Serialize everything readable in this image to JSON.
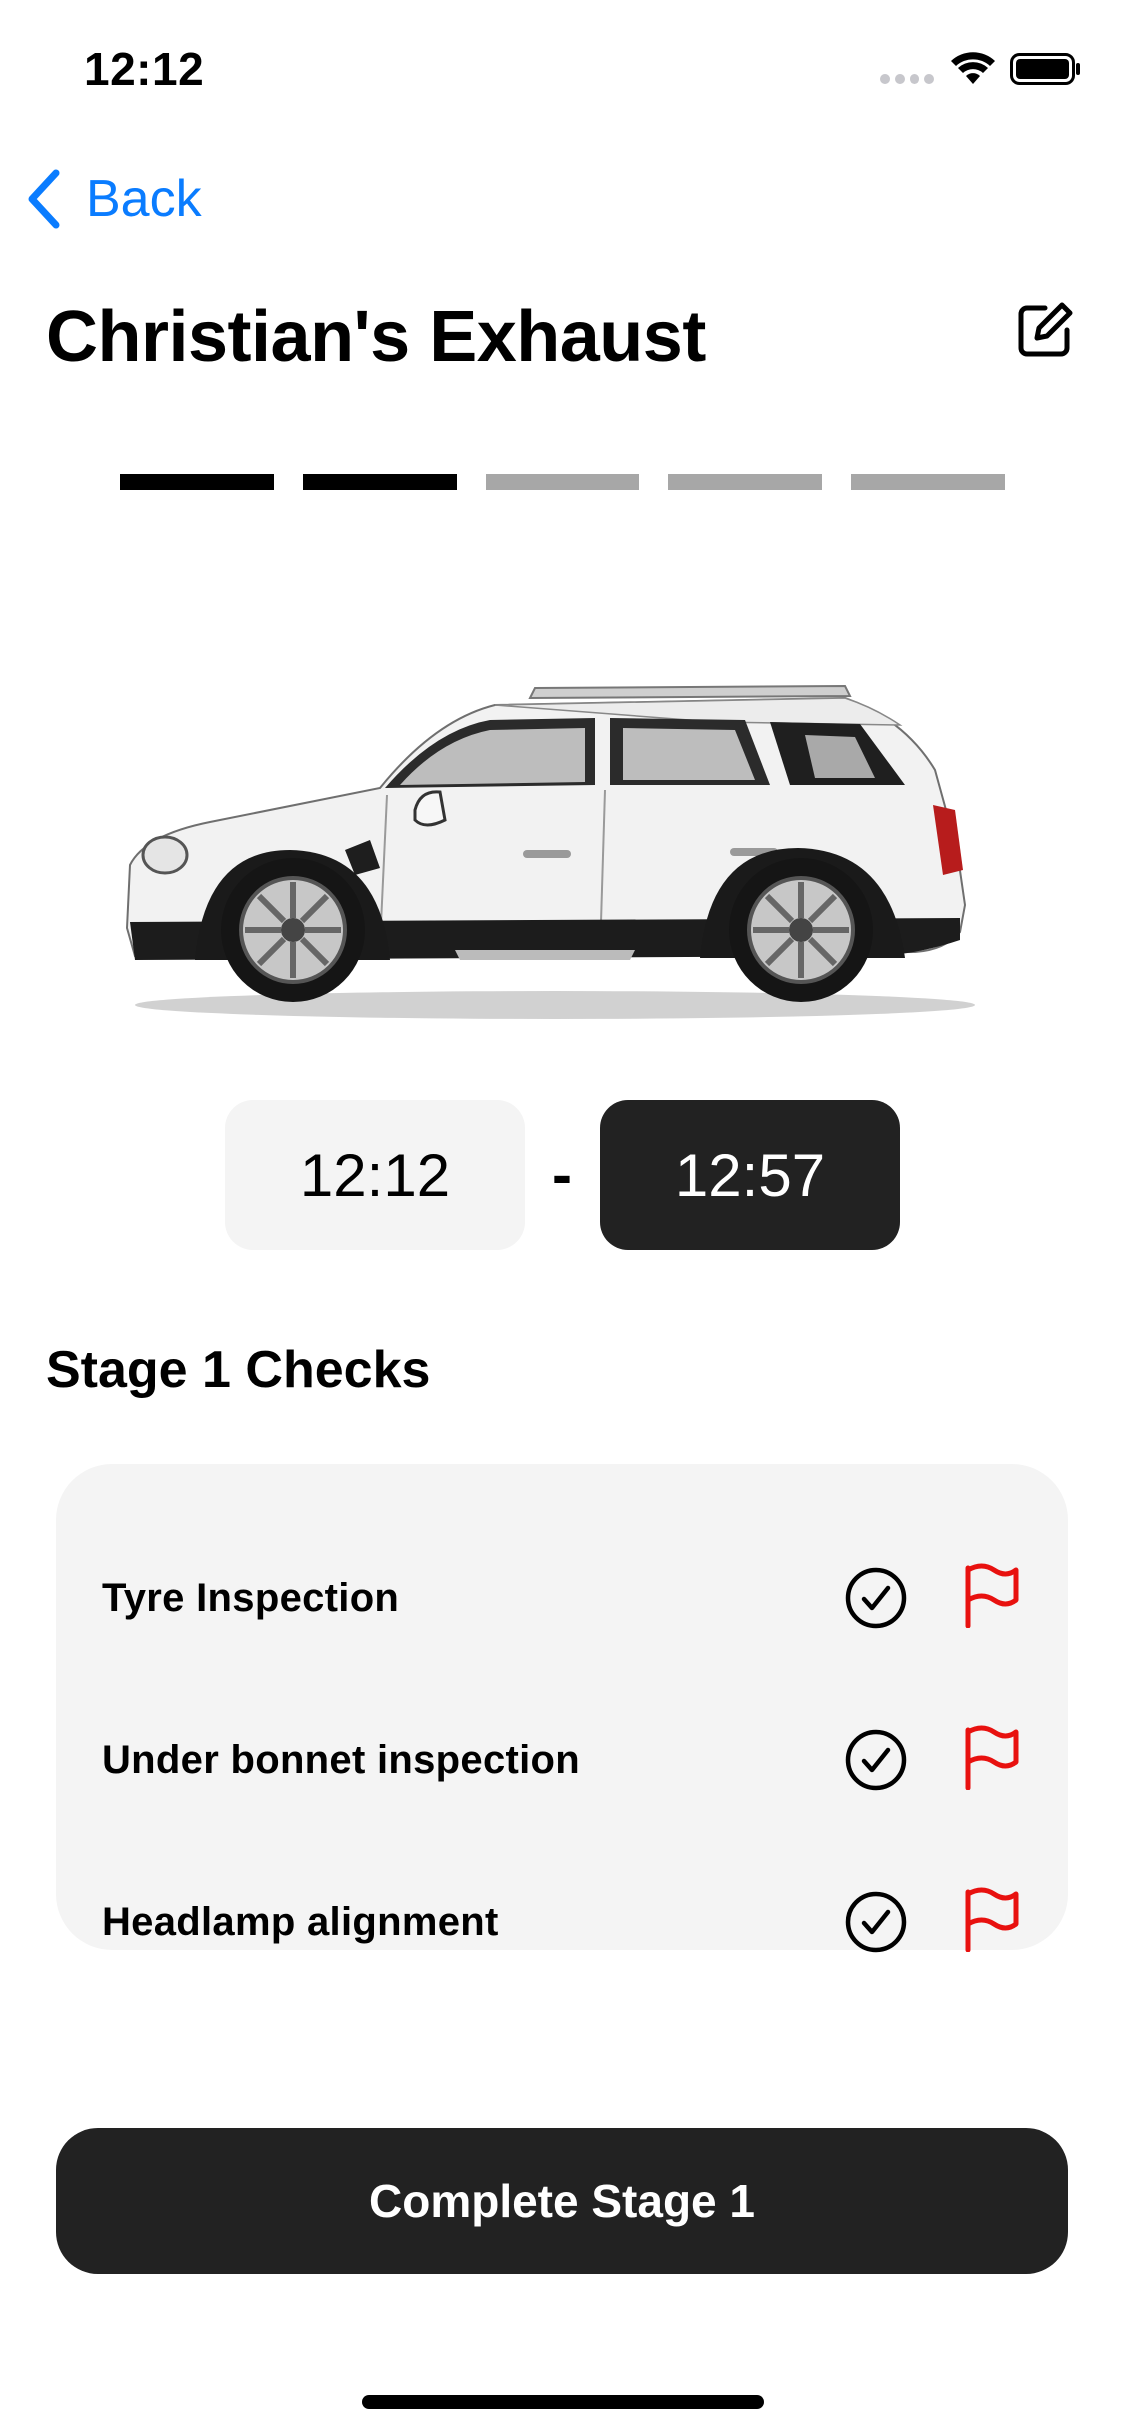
{
  "status_bar": {
    "time": "12:12"
  },
  "nav": {
    "back_label": "Back"
  },
  "header": {
    "title": "Christian's Exhaust",
    "edit_icon": "edit-square-icon"
  },
  "progress": {
    "total_stages": 5,
    "completed_stages": 2
  },
  "vehicle": {
    "image_icon": "car-side-image",
    "body_color": "#f2f2f2"
  },
  "times": {
    "start": "12:12",
    "separator": "-",
    "end": "12:57"
  },
  "checks": {
    "heading": "Stage 1 Checks",
    "items": [
      {
        "label": "Tyre Inspection"
      },
      {
        "label": "Under bonnet inspection"
      },
      {
        "label": "Headlamp alignment"
      }
    ]
  },
  "actions": {
    "complete_label": "Complete Stage 1"
  },
  "colors": {
    "accent_blue": "#0a7cff",
    "flag_red": "#e8110f",
    "dark": "#222222",
    "card_bg": "#f4f4f4",
    "progress_done": "#000000",
    "progress_todo": "#a7a7a7"
  }
}
